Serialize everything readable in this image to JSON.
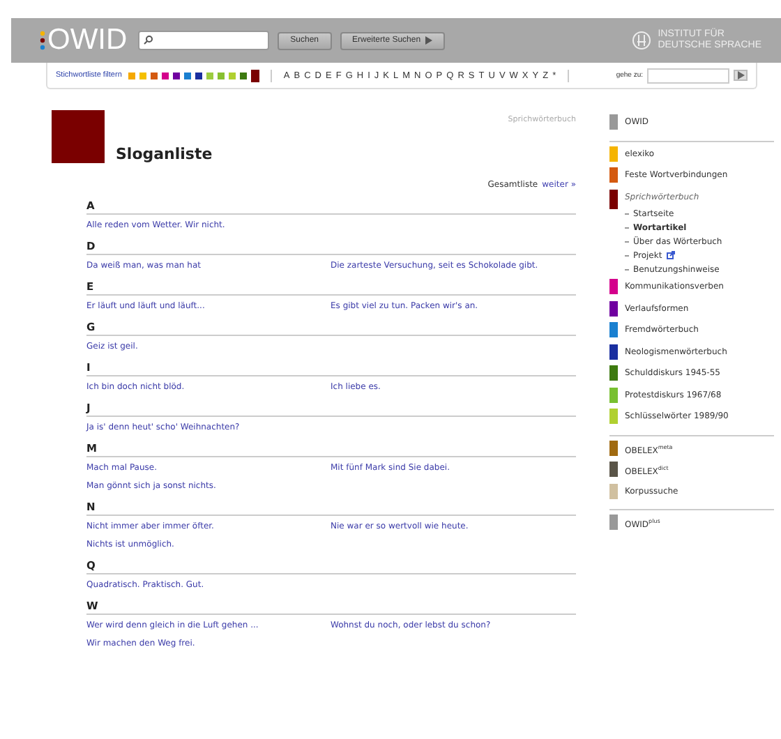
{
  "header": {
    "logo": "OWID",
    "search_button": "Suchen",
    "advanced_button": "Erweiterte Suchen",
    "institute": [
      "INSTITUT FÜR",
      "DEUTSCHE SPRACHE"
    ]
  },
  "filter_bar": {
    "label": "Stichwortliste filtern",
    "swatches": [
      {
        "color": "#f5a800",
        "selected": false
      },
      {
        "color": "#f5c000",
        "selected": false
      },
      {
        "color": "#d45a10",
        "selected": false
      },
      {
        "color": "#d4008c",
        "selected": false
      },
      {
        "color": "#7000a0",
        "selected": false
      },
      {
        "color": "#1a80d0",
        "selected": false
      },
      {
        "color": "#1a2fa0",
        "selected": false
      },
      {
        "color": "#9ccc40",
        "selected": false
      },
      {
        "color": "#88c030",
        "selected": false
      },
      {
        "color": "#b0d030",
        "selected": false
      },
      {
        "color": "#3d7a10",
        "selected": false
      },
      {
        "color": "#7a0000",
        "selected": true
      }
    ],
    "letters": [
      "A",
      "B",
      "C",
      "D",
      "E",
      "F",
      "G",
      "H",
      "I",
      "J",
      "K",
      "L",
      "M",
      "N",
      "O",
      "P",
      "Q",
      "R",
      "S",
      "T",
      "U",
      "V",
      "W",
      "X",
      "Y",
      "Z",
      "*"
    ],
    "goto_label": "gehe zu:"
  },
  "page": {
    "breadcrumb": "Sprichwörterbuch",
    "title": "Sloganliste",
    "overview_label": "Gesamtliste",
    "overview_link": "weiter »",
    "sections": [
      {
        "letter": "A",
        "slogans": [
          "Alle reden vom Wetter. Wir nicht."
        ]
      },
      {
        "letter": "D",
        "slogans": [
          "Da weiß man, was man hat",
          "Die zarteste Versuchung, seit es Schokolade gibt."
        ]
      },
      {
        "letter": "E",
        "slogans": [
          "Er läuft und läuft und läuft...",
          "Es gibt viel zu tun. Packen wir's an."
        ]
      },
      {
        "letter": "G",
        "slogans": [
          "Geiz ist geil."
        ]
      },
      {
        "letter": "I",
        "slogans": [
          "Ich bin doch nicht blöd.",
          "Ich liebe es."
        ]
      },
      {
        "letter": "J",
        "slogans": [
          "Ja is' denn heut' scho' Weihnachten?"
        ]
      },
      {
        "letter": "M",
        "slogans": [
          "Mach mal Pause.",
          "Mit fünf Mark sind Sie dabei.",
          "Man gönnt sich ja sonst nichts."
        ]
      },
      {
        "letter": "N",
        "slogans": [
          "Nicht immer aber immer öfter.",
          "Nie war er so wertvoll wie heute.",
          "Nichts ist unmöglich."
        ]
      },
      {
        "letter": "Q",
        "slogans": [
          "Quadratisch. Praktisch. Gut."
        ]
      },
      {
        "letter": "W",
        "slogans": [
          "Wer wird denn gleich in die Luft gehen ...",
          "Wohnst du noch, oder lebst du schon?",
          "Wir machen den Weg frei."
        ]
      }
    ]
  },
  "sidebar": {
    "groups": [
      {
        "items": [
          {
            "label": "OWID",
            "color": "#999999",
            "selected": false
          }
        ]
      },
      {
        "items": [
          {
            "label": "elexiko",
            "color": "#f5b400",
            "selected": false
          },
          {
            "label": "Feste Wortverbindungen",
            "color": "#d45a10",
            "selected": false
          },
          {
            "label": "Sprichwörterbuch",
            "color": "#7a0000",
            "selected": true,
            "children": [
              {
                "label": "Startseite",
                "selected": false,
                "external": false
              },
              {
                "label": "Wortartikel",
                "selected": true,
                "external": false
              },
              {
                "label": "Über das Wörterbuch",
                "selected": false,
                "external": false
              },
              {
                "label": "Projekt",
                "selected": false,
                "external": true
              },
              {
                "label": "Benutzungshinweise",
                "selected": false,
                "external": false
              }
            ]
          },
          {
            "label": "Kommunikationsverben",
            "color": "#d4008c",
            "selected": false
          },
          {
            "label": "Verlaufsformen",
            "color": "#7000a0",
            "selected": false
          },
          {
            "label": "Fremdwörterbuch",
            "color": "#1a80d0",
            "selected": false
          },
          {
            "label": "Neologismenwörterbuch",
            "color": "#1a2fa0",
            "selected": false
          },
          {
            "label": "Schulddiskurs 1945-55",
            "color": "#3d7a10",
            "selected": false
          },
          {
            "label": "Protestdiskurs 1967/68",
            "color": "#78c030",
            "selected": false
          },
          {
            "label": "Schlüsselwörter 1989/90",
            "color": "#b0d030",
            "selected": false
          }
        ]
      },
      {
        "items": [
          {
            "label": "OBELEX$^{meta}$",
            "color": "#a06a10",
            "selected": false
          },
          {
            "label": "OBELEX$^{dict}$",
            "color": "#5a5548",
            "selected": false
          },
          {
            "label": "Korpussuche",
            "color": "#d0c0a0",
            "selected": false
          }
        ]
      },
      {
        "items": [
          {
            "label": "OWID$^{plus}$",
            "color": "#999999",
            "selected": false
          }
        ]
      }
    ]
  }
}
